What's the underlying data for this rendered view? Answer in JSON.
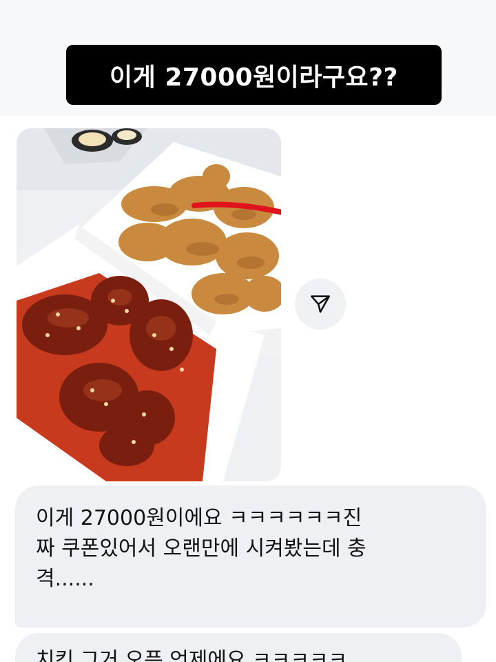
{
  "caption": "이게 27000원이라구요??",
  "photo": {
    "alt": "chicken"
  },
  "share_icon": "send-icon",
  "messages": [
    {
      "lines": [
        "이게 27000원이에요 ㅋㅋㅋㅋㅋㅋ진",
        "짜 쿠폰있어서 오랜만에 시켜봤는데 충",
        "격......"
      ]
    },
    {
      "lines": [
        "치킨 그거 오픈 언제에요 ㅋㅋㅋㅋㅋ"
      ]
    }
  ]
}
